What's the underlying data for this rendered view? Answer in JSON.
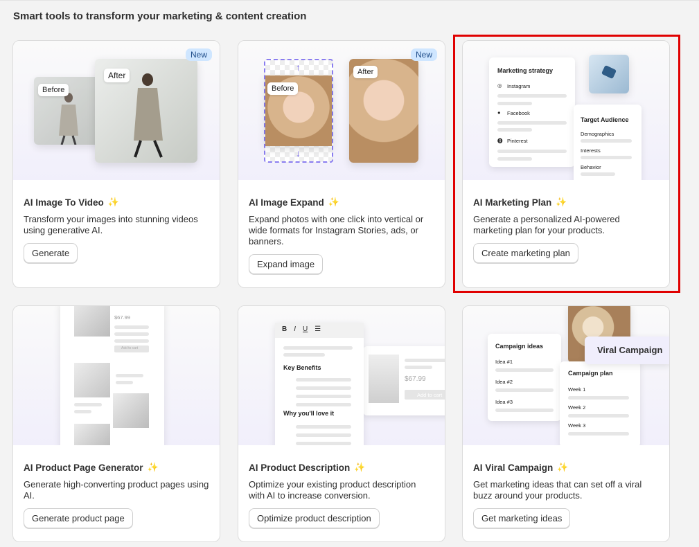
{
  "page": {
    "heading": "Smart tools to transform your marketing & content creation"
  },
  "cards": [
    {
      "title": "AI Image To Video",
      "desc": "Transform your images into stunning videos using generative AI.",
      "button": "Generate",
      "badge": "New",
      "hero": {
        "before": "Before",
        "after": "After"
      }
    },
    {
      "title": "AI Image Expand",
      "desc": "Expand photos with one click into vertical or wide formats for Instagram Stories, ads, or banners.",
      "button": "Expand image",
      "badge": "New",
      "hero": {
        "before": "Before",
        "after": "After"
      }
    },
    {
      "title": "AI Marketing Plan",
      "desc": "Generate a personalized AI-powered marketing plan for your products.",
      "button": "Create marketing plan",
      "hero": {
        "strategy_title": "Marketing strategy",
        "channels": [
          "Instagram",
          "Facebook",
          "Pinterest"
        ],
        "audience_title": "Target Audience",
        "audience_items": [
          "Demographics",
          "Interests",
          "Behavior"
        ]
      }
    },
    {
      "title": "AI Product Page Generator",
      "desc": "Generate high-converting product pages using AI.",
      "button": "Generate product page",
      "hero": {
        "price": "$67.99",
        "cart": "Add to cart"
      }
    },
    {
      "title": "AI Product Description",
      "desc": "Optimize your existing product description with AI to increase conversion.",
      "button": "Optimize product description",
      "hero": {
        "toolbar": [
          "B",
          "I",
          "U"
        ],
        "sections": [
          "Key Benefits",
          "Why you'll love it"
        ],
        "price": "$67.99",
        "cart": "Add to cart"
      }
    },
    {
      "title": "AI Viral Campaign",
      "desc": "Get marketing ideas that can set off a viral buzz around your products.",
      "button": "Get marketing ideas",
      "hero": {
        "ideas_title": "Campaign ideas",
        "ideas": [
          "Idea #1",
          "Idea #2",
          "Idea #3"
        ],
        "viral_label": "Viral Campaign",
        "plan_title": "Campaign plan",
        "weeks": [
          "Week 1",
          "Week 2",
          "Week 3"
        ]
      }
    }
  ],
  "colors": {
    "highlight": "#e00000",
    "badge_bg": "#cfe6ff",
    "sparkle": "#f2b53a"
  }
}
